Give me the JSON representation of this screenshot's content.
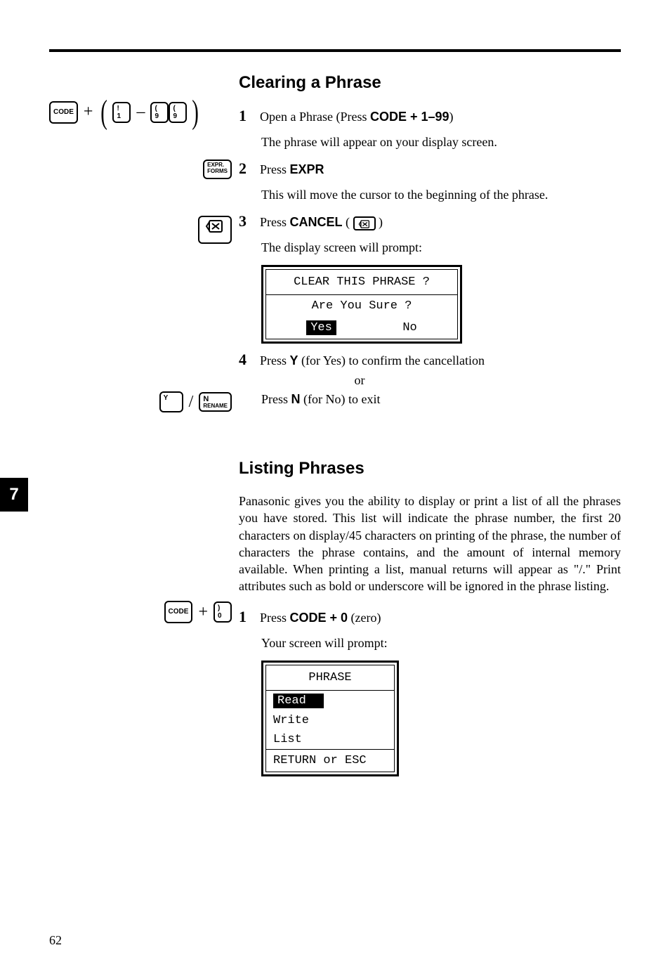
{
  "page_number": "62",
  "chapter_tab": "7",
  "section1": {
    "heading": "Clearing a Phrase",
    "step1": {
      "num": "1",
      "pre": "Open a Phrase (Press ",
      "bold": "CODE + 1–99",
      "post": ")",
      "sub": "The phrase will appear on your display screen."
    },
    "step2": {
      "num": "2",
      "pre": "Press ",
      "bold": "EXPR",
      "sub": "This will move the cursor to the beginning of the phrase."
    },
    "step3": {
      "num": "3",
      "pre": "Press ",
      "bold": "CANCEL",
      "paren_open": " ( ",
      "paren_close": " )",
      "sub": "The display screen will prompt:"
    },
    "prompt1": {
      "title": "CLEAR THIS PHRASE ?",
      "sub": "Are You Sure ?",
      "opt_yes": "Yes",
      "opt_no": "No"
    },
    "step4": {
      "num": "4",
      "line1_pre": "Press ",
      "line1_bold": "Y",
      "line1_post": " (for Yes) to confirm the cancellation",
      "or": "or",
      "line2_pre": "Press ",
      "line2_bold": "N",
      "line2_post": " (for No) to exit"
    }
  },
  "section2": {
    "heading": "Listing Phrases",
    "para": "Panasonic gives you the ability to display or print a list of all the phrases you have stored. This list will indicate the phrase number, the first 20 characters on display/45 characters on printing of the phrase, the number of characters the phrase contains, and the amount of internal memory available. When printing a list, manual returns will appear as \"/.\" Print attributes such as bold or underscore will be ignored in the phrase listing.",
    "step1": {
      "num": "1",
      "pre": "Press ",
      "bold": "CODE + 0",
      "post": " (zero)",
      "sub": "Your screen will prompt:"
    },
    "prompt2": {
      "title": "PHRASE",
      "opt_read": "Read",
      "opt_write": "Write",
      "opt_list": "List",
      "footer": "RETURN or ESC"
    }
  },
  "keys": {
    "code": "CODE",
    "k1_top": "!",
    "k1_bot": "1",
    "k9_top": "(",
    "k9_bot": "9",
    "expr_top": "EXPR.",
    "expr_bot": "FORMS",
    "y": "Y",
    "n_top": "N",
    "n_bot": "RENAME",
    "k0_top": ")",
    "k0_bot": "0"
  }
}
